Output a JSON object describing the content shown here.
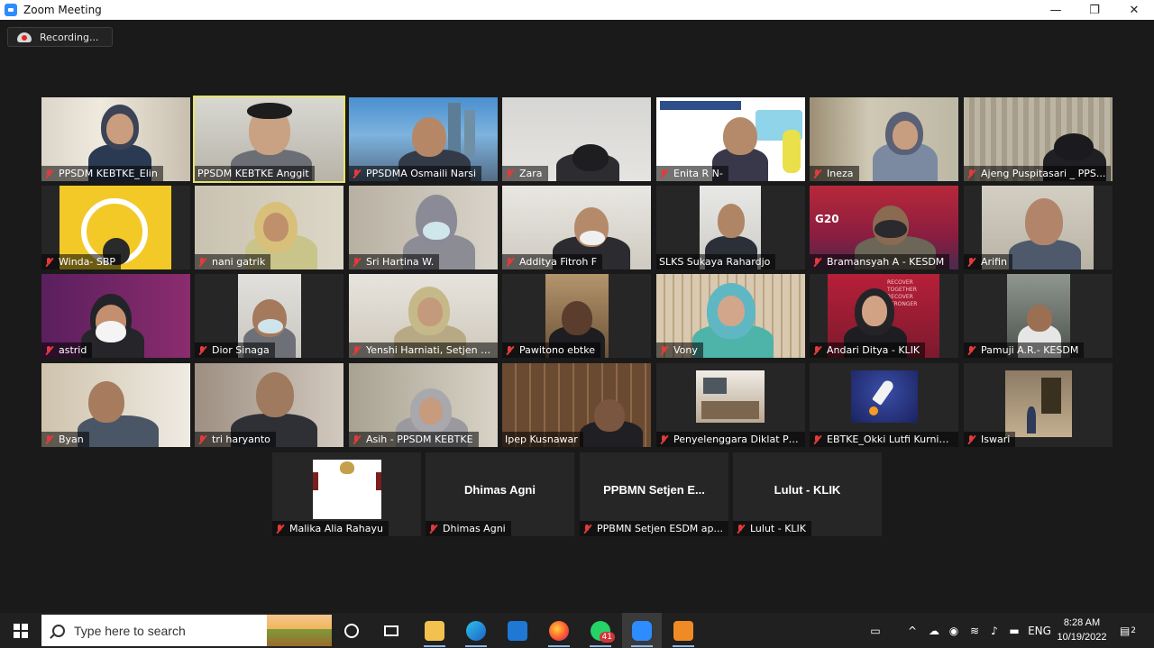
{
  "window": {
    "title": "Zoom Meeting",
    "minimize": "—",
    "maximize": "❐",
    "close": "✕"
  },
  "recording": {
    "label": "Recording..."
  },
  "participants": [
    {
      "name": "PPSDM KEBTKE_Elin",
      "muted": true
    },
    {
      "name": "PPSDM KEBTKE Anggit",
      "muted": false,
      "speaking": true
    },
    {
      "name": "PPSDMA Osmaili Narsi",
      "muted": true
    },
    {
      "name": "Zara",
      "muted": true
    },
    {
      "name": "Enita R N-",
      "muted": true
    },
    {
      "name": "Ineza",
      "muted": true
    },
    {
      "name": "Ajeng Puspitasari _ PPS...",
      "muted": true
    },
    {
      "name": "Winda- SBP",
      "muted": true
    },
    {
      "name": "nani gatrik",
      "muted": true
    },
    {
      "name": "Sri Hartina W.",
      "muted": true
    },
    {
      "name": "Additya Fitroh F",
      "muted": true
    },
    {
      "name": "SLKS Sukaya Rahardjo",
      "muted": false
    },
    {
      "name": "Bramansyah A - KESDM",
      "muted": true
    },
    {
      "name": "Arifin",
      "muted": true
    },
    {
      "name": "astrid",
      "muted": true
    },
    {
      "name": "Dior Sinaga",
      "muted": true
    },
    {
      "name": "Yenshi Harniati, Setjen D...",
      "muted": true
    },
    {
      "name": "Pawitono ebtke",
      "muted": true
    },
    {
      "name": "Vony",
      "muted": true
    },
    {
      "name": "Andari Ditya - KLIK",
      "muted": true
    },
    {
      "name": "Pamuji A.R.- KESDM",
      "muted": true
    },
    {
      "name": "Byan",
      "muted": true
    },
    {
      "name": "tri haryanto",
      "muted": true
    },
    {
      "name": "Asih - PPSDM KEBTKE",
      "muted": true
    },
    {
      "name": "Ipep Kusnawar",
      "muted": false
    },
    {
      "name": "Penyelenggara Diklat PP...",
      "muted": true
    },
    {
      "name": "EBTKE_Okki Lutfi Kurnia...",
      "muted": true
    },
    {
      "name": "Iswari",
      "muted": true
    },
    {
      "name": "Malika Alia Rahayu",
      "muted": true
    },
    {
      "name": "Dhimas Agni",
      "muted": true,
      "display": "Dhimas Agni"
    },
    {
      "name": "PPBMN Setjen ESDM ap...",
      "muted": true,
      "display": "PPBMN  Setjen  E..."
    },
    {
      "name": "Lulut - KLIK",
      "muted": true,
      "display": "Lulut - KLIK"
    }
  ],
  "tile_text": {
    "g20": "G20",
    "recover": "RECOVER TOGETHER RECOVER STRONGER"
  },
  "taskbar": {
    "search_placeholder": "Type here to search",
    "whatsapp_badge": "41",
    "language": "ENG",
    "time": "8:28 AM",
    "date": "10/19/2022",
    "notifications_count": "2"
  }
}
